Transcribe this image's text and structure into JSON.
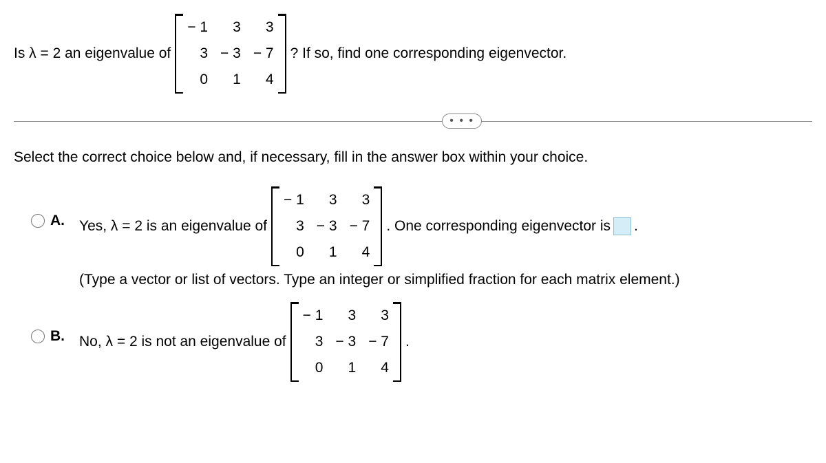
{
  "question": {
    "prefix": "Is λ = 2 an eigenvalue of",
    "suffix": "? If so, find one corresponding eigenvector.",
    "matrix": [
      "− 1",
      "3",
      "3",
      "3",
      "− 3",
      "− 7",
      "0",
      "1",
      "4"
    ]
  },
  "ellipsis": "•  •  •",
  "instruction": "Select the correct choice below and, if necessary, fill in the answer box within your choice.",
  "choices": {
    "a": {
      "letter": "A.",
      "text_before": "Yes, λ = 2 is an eigenvalue of",
      "text_after": ". One corresponding eigenvector is",
      "period": ".",
      "matrix": [
        "− 1",
        "3",
        "3",
        "3",
        "− 3",
        "− 7",
        "0",
        "1",
        "4"
      ],
      "hint": "(Type a vector or list of vectors. Type an integer or simplified fraction for each matrix element.)"
    },
    "b": {
      "letter": "B.",
      "text_before": "No, λ = 2 is not an eigenvalue of",
      "period": ".",
      "matrix": [
        "− 1",
        "3",
        "3",
        "3",
        "− 3",
        "− 7",
        "0",
        "1",
        "4"
      ]
    }
  }
}
